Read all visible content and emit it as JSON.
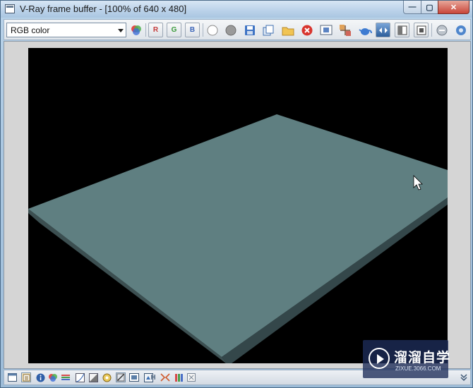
{
  "window": {
    "title": "V-Ray frame buffer - [100% of 640 x 480]",
    "minimize_glyph": "—",
    "maximize_glyph": "▢",
    "close_glyph": "✕"
  },
  "toolbar": {
    "channel_select_value": "RGB color",
    "channel_r": "R",
    "channel_g": "G",
    "channel_b": "B",
    "icons": [
      "color-wheel-icon",
      "channel-r-icon",
      "channel-g-icon",
      "channel-b-icon",
      "white-circle-icon",
      "gray-circle-icon",
      "save-icon",
      "copy-icon",
      "folder-icon",
      "clear-icon",
      "region-render-icon",
      "track-mouse-icon",
      "teapot-icon",
      "color-correction-icon",
      "compare-icon",
      "lens-effects-icon",
      "stop-icon",
      "settings-icon"
    ]
  },
  "render": {
    "background_color": "#000000",
    "floor_color": "#5f7f81",
    "floor_edge_color": "#3c4f51"
  },
  "statusbar": {
    "h_label": "H",
    "icons": [
      "window-icon",
      "history-icon",
      "info-icon",
      "color-icon",
      "levels-icon",
      "curve-icon",
      "exposure-icon",
      "edit-icon",
      "settings-icon",
      "lut-icon",
      "ocio-icon",
      "h-icon",
      "compare-ab-icon",
      "channel-bars-icon",
      "expand-icon",
      "collapse-icon"
    ]
  },
  "watermark": {
    "brand_text": "溜溜自学",
    "brand_url": "ZIXUE.3066.COM"
  }
}
